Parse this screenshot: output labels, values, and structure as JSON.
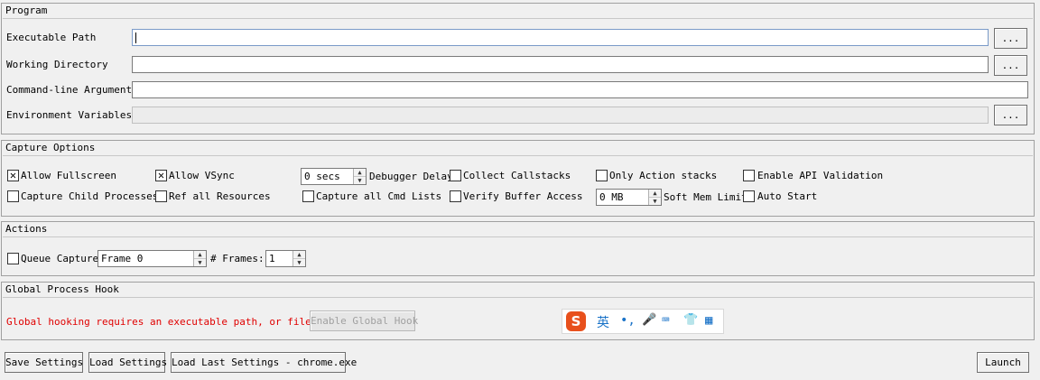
{
  "program": {
    "title": "Program",
    "exe_label": "Executable Path",
    "exe_value": "",
    "workdir_label": "Working Directory",
    "workdir_value": "",
    "cmdline_label": "Command-line Arguments",
    "cmdline_value": "",
    "env_label": "Environment Variables",
    "env_value": "",
    "browse_label": "..."
  },
  "capture": {
    "title": "Capture Options",
    "allow_fullscreen": {
      "label": "Allow Fullscreen",
      "checked": true
    },
    "allow_vsync": {
      "label": "Allow VSync",
      "checked": true
    },
    "debugger_delay_value": "0 secs",
    "debugger_delay_label": "Debugger Delay",
    "collect_callstacks": {
      "label": "Collect Callstacks",
      "checked": false
    },
    "only_action_stacks": {
      "label": "Only Action stacks",
      "checked": false
    },
    "enable_api_validation": {
      "label": "Enable API Validation",
      "checked": false
    },
    "capture_child": {
      "label": "Capture Child Processes",
      "checked": false
    },
    "ref_all_resources": {
      "label": "Ref all Resources",
      "checked": false
    },
    "capture_all_cmd_lists": {
      "label": "Capture all Cmd Lists",
      "checked": false
    },
    "verify_buffer_access": {
      "label": "Verify Buffer Access",
      "checked": false
    },
    "soft_mem_value": "0 MB",
    "soft_mem_label": "Soft Mem Limit",
    "auto_start": {
      "label": "Auto Start",
      "checked": false
    }
  },
  "actions": {
    "title": "Actions",
    "queue_capture": {
      "label": "Queue Capture",
      "checked": false
    },
    "frame_value": "Frame 0",
    "frames_label": "# Frames:",
    "frames_value": "1"
  },
  "hook": {
    "title": "Global Process Hook",
    "message": "Global hooking requires an executable path, or filename",
    "enable_label": "Enable Global Hook"
  },
  "footer": {
    "save_label": "Save Settings",
    "load_label": "Load Settings",
    "load_last_label": "Load Last Settings - chrome.exe",
    "launch_label": "Launch"
  },
  "ime": {
    "lang": "英",
    "punct": "•,",
    "mic": "🎤",
    "keyboard": "⌨",
    "shirt": "👕",
    "grid": "▦"
  },
  "colors": {
    "error_text": "#e00000",
    "ime_accent": "#e8501c",
    "ime_icons": "#1a73c8"
  }
}
